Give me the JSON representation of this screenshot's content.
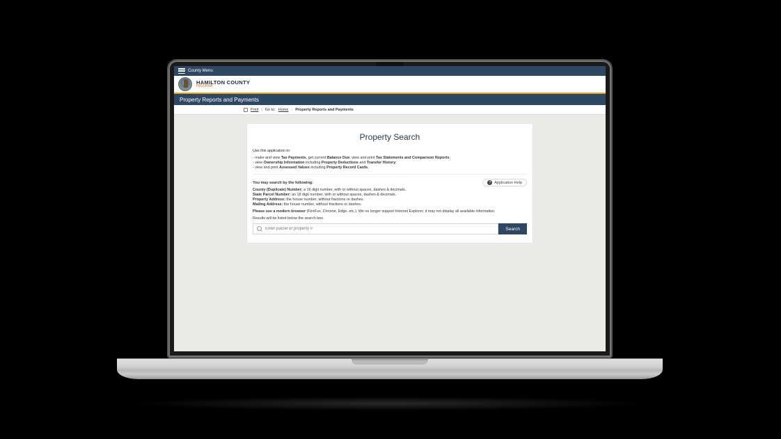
{
  "topbar": {
    "menu_label": "County Menu"
  },
  "logo": {
    "line1": "HAMILTON COUNTY",
    "line2": "INDIANA"
  },
  "section": {
    "title": "Property Reports and Payments"
  },
  "breadcrumb": {
    "print": "Print",
    "prefix": "Go to:",
    "home": "Home",
    "current": "Property Reports and Payments"
  },
  "card": {
    "title": "Property Search",
    "intro": "Use this application to:",
    "uses": [
      {
        "pre": "- make and view ",
        "b1": "Tax Payments",
        "mid1": ", get current ",
        "b2": "Balance Due",
        "mid2": "; view and print ",
        "b3": "Tax Statements and Comparison Reports",
        "post": ";"
      },
      {
        "pre": "- view ",
        "b1": "Ownership Information",
        "mid1": " including ",
        "b2": "Property Deductions",
        "mid2": " and ",
        "b3": "Transfer History",
        "post": ";"
      },
      {
        "pre": "- view and print ",
        "b1": "Assessed Values",
        "mid1": " including ",
        "b2": "Property Record Cards.",
        "mid2": "",
        "b3": "",
        "post": ""
      }
    ],
    "help_label": "Application Help",
    "instructions_lead": "You may search by the following:",
    "instructions": [
      {
        "b": "County (Duplicate) Number:",
        "t": " a 16 digit number, with or without spaces, dashes & decimals."
      },
      {
        "b": "State Parcel Number:",
        "t": " an 18 digit number, with or without spaces, dashes & decimals."
      },
      {
        "b": "Property Address:",
        "t": " the house number, without fractions or dashes."
      },
      {
        "b": "Mailing Address:",
        "t": " the house number, without fractions or dashes."
      }
    ],
    "browser_note_b": "Please use a modern browser",
    "browser_note_t": " (FireFox, Chrome, Edge, etc.). We no longer support Internet Explorer; it may not display all available information.",
    "results_note": "Results will be listed below the search box.",
    "search": {
      "placeholder": "Enter parcel or property #",
      "button": "Search"
    }
  }
}
